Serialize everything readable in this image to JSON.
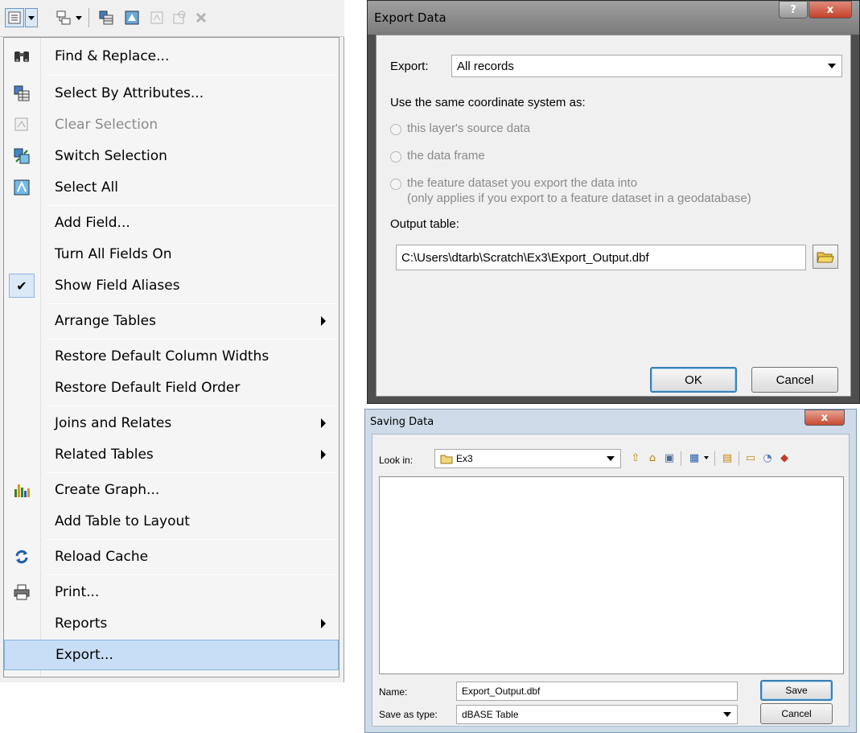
{
  "menu": {
    "items": [
      {
        "label": "Find & Replace...",
        "icon": "binoculars-icon"
      },
      {
        "label": "Select By Attributes...",
        "icon": "select-by-attributes-icon"
      },
      {
        "label": "Clear Selection",
        "icon": "clear-selection-icon",
        "disabled": true
      },
      {
        "label": "Switch Selection",
        "icon": "switch-selection-icon"
      },
      {
        "label": "Select All",
        "icon": "select-all-icon"
      },
      {
        "label": "Add Field..."
      },
      {
        "label": "Turn All Fields On"
      },
      {
        "label": "Show Field Aliases",
        "checked": true
      },
      {
        "label": "Arrange Tables",
        "submenu": true
      },
      {
        "label": "Restore Default Column Widths"
      },
      {
        "label": "Restore Default Field Order"
      },
      {
        "label": "Joins and Relates",
        "submenu": true
      },
      {
        "label": "Related Tables",
        "submenu": true
      },
      {
        "label": "Create Graph...",
        "icon": "graph-icon"
      },
      {
        "label": "Add Table to Layout"
      },
      {
        "label": "Reload Cache",
        "icon": "reload-icon"
      },
      {
        "label": "Print...",
        "icon": "printer-icon"
      },
      {
        "label": "Reports",
        "submenu": true
      },
      {
        "label": "Export...",
        "highlighted": true
      }
    ]
  },
  "export_dialog": {
    "title": "Export Data",
    "help_button": "?",
    "close_button": "x",
    "export_label": "Export:",
    "export_value": "All records",
    "coord_label": "Use the same coordinate system as:",
    "options": [
      "this layer's source data",
      "the data frame",
      "the feature dataset you export the data into"
    ],
    "option_note": "(only applies if you export to a feature dataset in a geodatabase)",
    "output_label": "Output table:",
    "output_value": "C:\\Users\\dtarb\\Scratch\\Ex3\\Export_Output.dbf",
    "ok_label": "OK",
    "cancel_label": "Cancel"
  },
  "saving_dialog": {
    "title": "Saving Data",
    "close_button": "x",
    "look_in_label": "Look in:",
    "look_in_value": "Ex3",
    "name_label": "Name:",
    "name_value": "Export_Output.dbf",
    "type_label": "Save as type:",
    "type_value": "dBASE Table",
    "save_label": "Save",
    "cancel_label": "Cancel"
  },
  "colors": {
    "menu_highlight": "#c8def6",
    "default_button_border": "#3c7fb1"
  }
}
